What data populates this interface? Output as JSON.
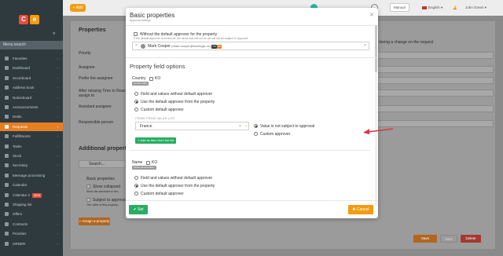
{
  "topbar": {
    "add_label": "+ Add",
    "manual_label": "Manual",
    "language_label": "English",
    "notifications_count": "1",
    "user_label": "John Green"
  },
  "sidebar": {
    "logo": [
      "C",
      "e"
    ],
    "menu_header": "Menu search",
    "items": [
      {
        "label": "Favorites"
      },
      {
        "label": "Dashboard"
      },
      {
        "label": "Scoreboard"
      },
      {
        "label": "Address book"
      },
      {
        "label": "Noticeboard"
      },
      {
        "label": "Announcements"
      },
      {
        "label": "Deals"
      },
      {
        "label": "Requests",
        "active": true
      },
      {
        "label": "Fulfillments"
      },
      {
        "label": "Tasks"
      },
      {
        "label": "Stock"
      },
      {
        "label": "Secretary"
      },
      {
        "label": "Message processing"
      },
      {
        "label": "Calendar"
      },
      {
        "label": "Calendar 2",
        "badge": "NEW"
      },
      {
        "label": "Shipping list"
      },
      {
        "label": "Offers"
      },
      {
        "label": "Contracts"
      },
      {
        "label": "Priorities"
      },
      {
        "label": "ORDER"
      }
    ]
  },
  "background": {
    "section_title": "Properties",
    "labels": [
      "Priority",
      "Assignee",
      "Prefer the assignee",
      "After missing Time to React assign to",
      "Assistant assignee",
      "Responsible person"
    ],
    "right_note": "during a change on the request",
    "additional_title": "Additional properties",
    "search_placeholder": "Search...",
    "basic_properties": "Basic properties",
    "show_collapsed": "Show collapsed",
    "show_collapsed_note": "Show the checkbox in the...",
    "subject_to_approval": "Subject to approval",
    "subject_note": "The value of this property...",
    "assign_props_label": "+ Assign a property",
    "save_label": "Save",
    "next_label": "Next",
    "delete_label": "Delete"
  },
  "modal": {
    "title": "Basic properties",
    "subtitle": "Approval settings",
    "without_default_label": "Without the default approver for the property",
    "without_default_note": "If the default approver is turned off, the items that will not be set will not be subject to approval",
    "approver_name": "Mark Cooper",
    "approver_email": "(mark.cooper@incelogic.cz)",
    "approver_tag1": "OK",
    "approver_tag2": "ON",
    "section_heading": "Property field options",
    "country_label": "Country",
    "country_ko": "KO",
    "country_tag": "Country (list)",
    "opt_field_no_default": "Field and values without default approver",
    "opt_use_default": "Use the default approver from the property",
    "opt_custom": "Custom default approver",
    "items_from_list_label": "ITEMS FROM VALUE LIST",
    "selected_value": "France",
    "value_not_subject": "Value is not subject to approval",
    "custom_approver": "Custom approver",
    "add_item_label": "+ Add an item from the list",
    "name_label": "Name",
    "name_ko": "KO",
    "name_tag": "Name (text/number)",
    "name_opt_field_no_default": "Field and values without default approver",
    "name_opt_use_default": "Use the default approver from the property",
    "name_opt_custom": "Custom default approver",
    "save_label": "Set",
    "cancel_label": "Cancel"
  },
  "colors": {
    "accent": "#e67e22",
    "success": "#27ae60",
    "warning": "#f39c12",
    "danger": "#e74c3c",
    "arrow": "#d9363e"
  }
}
